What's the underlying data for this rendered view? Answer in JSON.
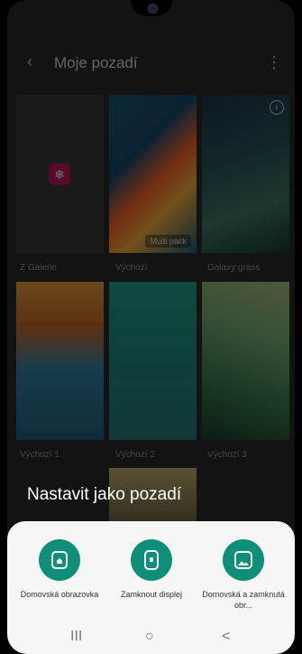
{
  "appbar": {
    "title": "Moje pozadí",
    "back_icon": "chevron-left-icon",
    "more_icon": "more-vert-icon"
  },
  "wallpapers": [
    {
      "label": "Z Galerie",
      "icon": "gallery-icon",
      "colors": [
        "#3a3a3a",
        "#3a3a3a"
      ]
    },
    {
      "label": "Výchozí",
      "badge": "Multi pack",
      "colors": [
        "#ff6a2b",
        "#1d5a7b"
      ]
    },
    {
      "label": "Galaxy grass",
      "colors": [
        "#2b5c5e",
        "#3e7d68"
      ]
    },
    {
      "label": "Výchozí 1",
      "colors": [
        "#e8a43a",
        "#3486a8"
      ]
    },
    {
      "label": "Výchozí 2",
      "colors": [
        "#21a48a",
        "#2b7c7f"
      ]
    },
    {
      "label": "Výchozí 3",
      "colors": [
        "#77b07b",
        "#357c4a"
      ]
    }
  ],
  "sheet": {
    "title": "Nastavit jako pozadí",
    "options": [
      {
        "label": "Domovská obrazovka",
        "icon": "home-screen-icon"
      },
      {
        "label": "Zamknout displej",
        "icon": "lock-screen-icon"
      },
      {
        "label": "Domovská a zamknutá obr...",
        "icon": "home-and-lock-icon"
      }
    ]
  },
  "navbar": {
    "recents": "III",
    "home": "○",
    "back": "<"
  }
}
